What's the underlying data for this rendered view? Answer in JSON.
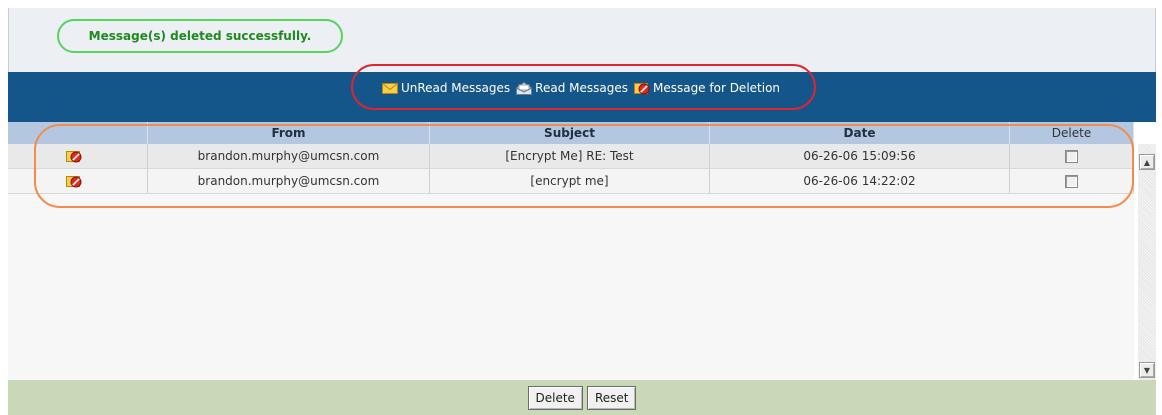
{
  "status": {
    "message": "Message(s) deleted successfully."
  },
  "legend": {
    "unread_label": "UnRead Messages",
    "read_label": "Read Messages",
    "deletion_label": "Message for Deletion"
  },
  "table": {
    "headers": {
      "from": "From",
      "subject": "Subject",
      "date": "Date",
      "delete": "Delete"
    },
    "rows": [
      {
        "from": "brandon.murphy@umcsn.com",
        "subject": "[Encrypt Me] RE: Test",
        "date": "06-26-06 15:09:56",
        "icon": "message-for-deletion-icon"
      },
      {
        "from": "brandon.murphy@umcsn.com",
        "subject": "[encrypt me]",
        "date": "06-26-06 14:22:02",
        "icon": "message-for-deletion-icon"
      }
    ]
  },
  "buttons": {
    "delete": "Delete",
    "reset": "Reset"
  },
  "colors": {
    "header_band": "#14568a",
    "column_header": "#b3c8e0",
    "footer_bar": "#c9d9b8",
    "status_text": "#1f8a1f",
    "status_outline": "#5ad35a",
    "legend_outline": "#e0242f",
    "rows_outline": "#f48b4c"
  }
}
